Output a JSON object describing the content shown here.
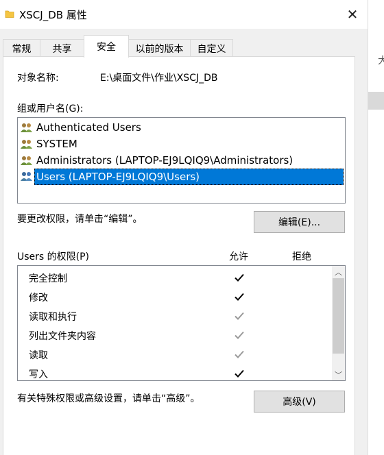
{
  "window": {
    "title": "XSCJ_DB 属性",
    "close_glyph": "✕"
  },
  "background": {
    "glyph": "大"
  },
  "tabs": [
    {
      "label": "常规",
      "active": false
    },
    {
      "label": "共享",
      "active": false
    },
    {
      "label": "安全",
      "active": true
    },
    {
      "label": "以前的版本",
      "active": false
    },
    {
      "label": "自定义",
      "active": false
    }
  ],
  "security": {
    "object_name_label": "对象名称:",
    "object_name_value": "E:\\桌面文件\\作业\\XSCJ_DB",
    "groups_label": "组或用户名(G):",
    "groups": [
      {
        "name": "Authenticated Users",
        "selected": false
      },
      {
        "name": "SYSTEM",
        "selected": false
      },
      {
        "name": "Administrators (LAPTOP-EJ9LQIQ9\\Administrators)",
        "selected": false
      },
      {
        "name": "Users (LAPTOP-EJ9LQIQ9\\Users)",
        "selected": true
      }
    ],
    "edit_hint": "要更改权限，请单击“编辑”。",
    "edit_button": "编辑(E)...",
    "permissions_label": "Users 的权限(P)",
    "allow_header": "允许",
    "deny_header": "拒绝",
    "permissions": [
      {
        "name": "完全控制",
        "allow": "check",
        "deny": "none"
      },
      {
        "name": "修改",
        "allow": "check",
        "deny": "none"
      },
      {
        "name": "读取和执行",
        "allow": "inherited",
        "deny": "none"
      },
      {
        "name": "列出文件夹内容",
        "allow": "inherited",
        "deny": "none"
      },
      {
        "name": "读取",
        "allow": "inherited",
        "deny": "none"
      },
      {
        "name": "写入",
        "allow": "check",
        "deny": "none"
      }
    ],
    "advanced_hint": "有关特殊权限或高级设置，请单击“高级”。",
    "advanced_button": "高级(V)"
  },
  "colors": {
    "selection": "#0078d7",
    "check": "#000000",
    "check_inherited": "#9a9a9a"
  }
}
